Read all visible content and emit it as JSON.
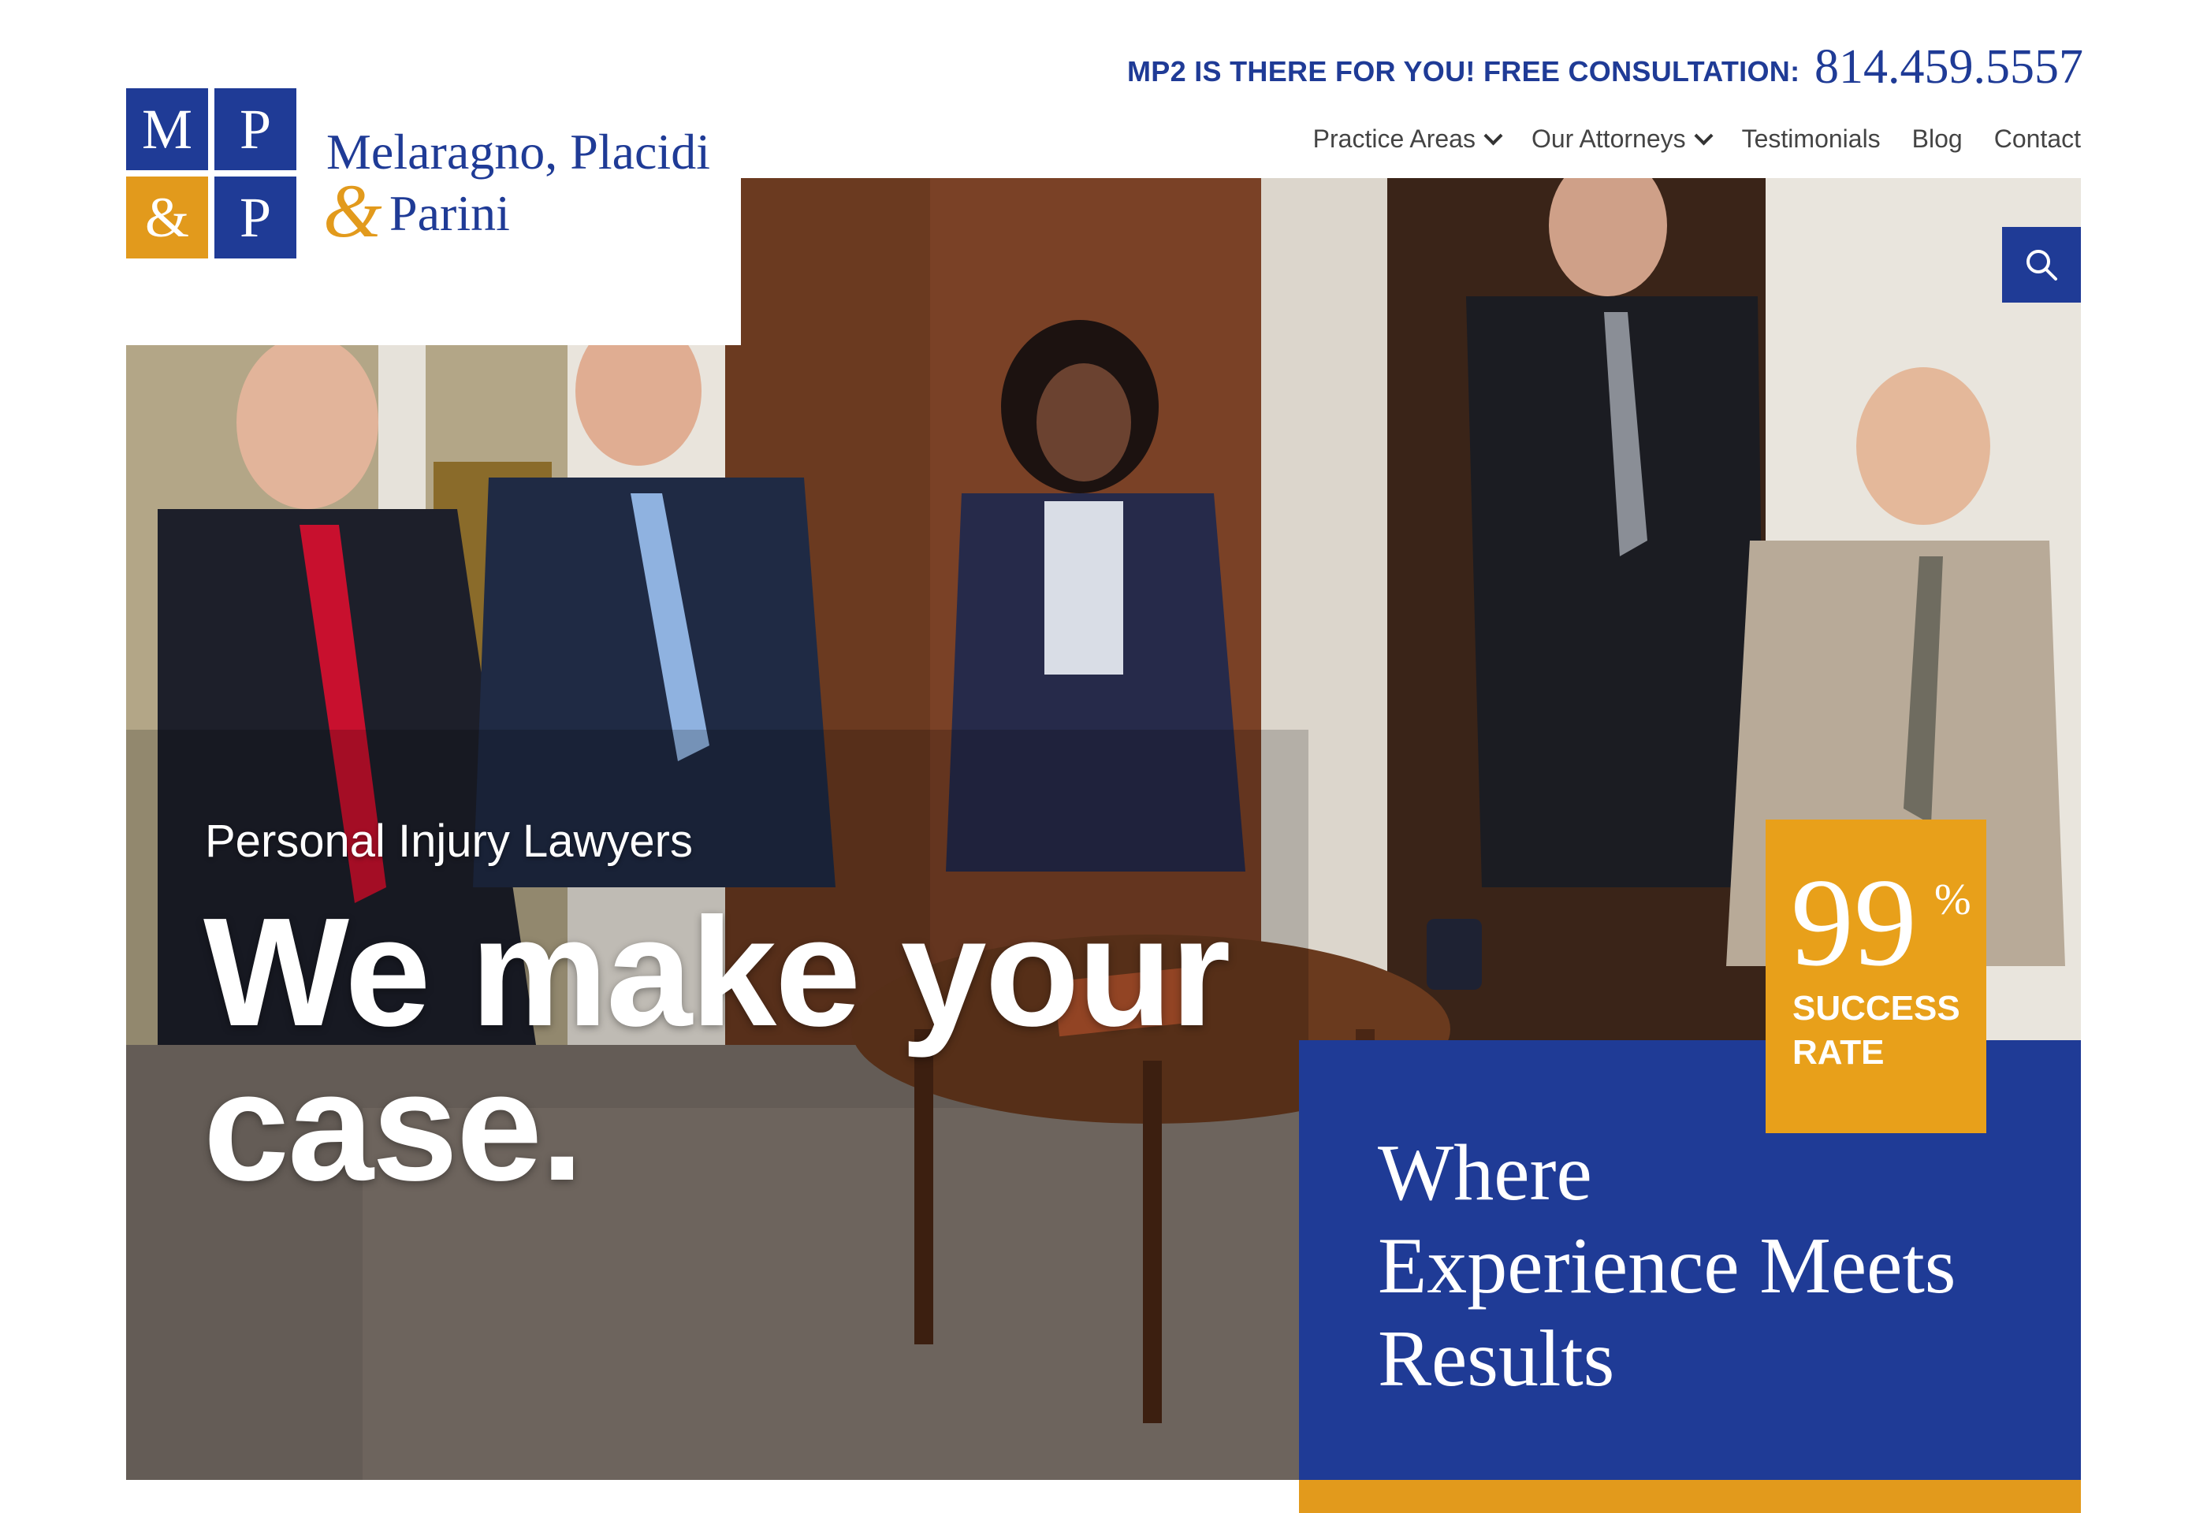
{
  "brand": {
    "logo_letters": [
      "M",
      "P",
      "&",
      "P"
    ],
    "name_line1": "Melaragno, Placidi",
    "name_amp": "&",
    "name_line2": "Parini",
    "primary_color": "#1f3b96",
    "accent_color": "#e29a1c"
  },
  "header": {
    "consult_text": "MP2 IS THERE FOR YOU! FREE CONSULTATION:",
    "phone": "814.459.5557"
  },
  "nav": {
    "items": [
      {
        "label": "Practice Areas",
        "has_dropdown": true
      },
      {
        "label": "Our Attorneys",
        "has_dropdown": true
      },
      {
        "label": "Testimonials",
        "has_dropdown": false
      },
      {
        "label": "Blog",
        "has_dropdown": false
      },
      {
        "label": "Contact",
        "has_dropdown": false
      }
    ],
    "search_icon": "search-icon"
  },
  "hero": {
    "eyebrow": "Personal Injury Lawyers",
    "headline_line1": "We make your",
    "headline_line2": "case."
  },
  "badge": {
    "number": "99",
    "percent": "%",
    "label": "SUCCESS RATE"
  },
  "tagline": {
    "line1": "Where",
    "line2": "Experience Meets",
    "line3": "Results"
  }
}
